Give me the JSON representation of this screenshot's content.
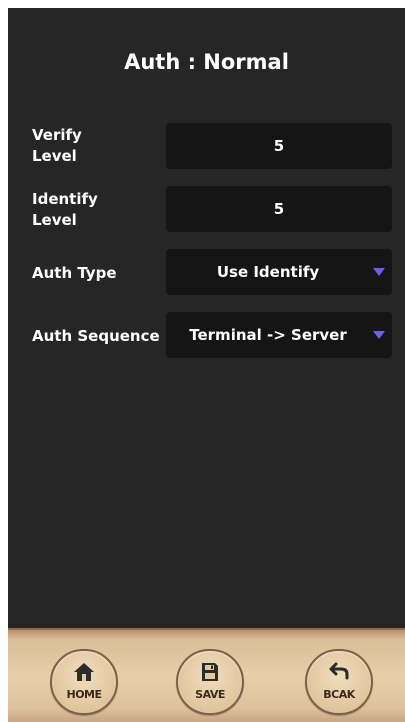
{
  "header": {
    "title": "Auth : Normal"
  },
  "form": {
    "verify_level": {
      "label_line1": "Verify",
      "label_line2": "Level",
      "value": "5"
    },
    "identify_level": {
      "label_line1": "Identify",
      "label_line2": "Level",
      "value": "5"
    },
    "auth_type": {
      "label": "Auth Type",
      "value": "Use Identify"
    },
    "auth_sequence": {
      "label": "Auth Sequence",
      "value": "Terminal -> Server"
    }
  },
  "bottom_nav": {
    "home": {
      "label": "HOME",
      "icon": "home-icon"
    },
    "save": {
      "label": "SAVE",
      "icon": "save-icon"
    },
    "back": {
      "label": "BCAK",
      "icon": "back-arrow-icon"
    }
  },
  "colors": {
    "background": "#262626",
    "field_background": "#151515",
    "dropdown_arrow": "#6a60ea",
    "bottom_bar": "#e8cfaa"
  }
}
